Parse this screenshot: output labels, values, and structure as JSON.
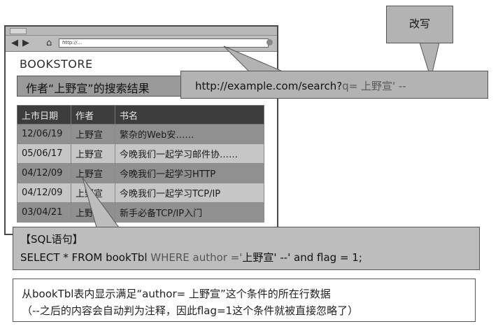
{
  "browser": {
    "url": "http://...",
    "store_name": "BOOKSTORE",
    "result_heading": "作者“上野宣”的搜索结果",
    "columns": [
      "上市日期",
      "作者",
      "书名"
    ],
    "rows": [
      {
        "date": "12/06/19",
        "author": "上野宣",
        "title": "繁杂的Web安……"
      },
      {
        "date": "05/06/17",
        "author": "上野宣",
        "title": "今晚我们一起学习邮件协……"
      },
      {
        "date": "04/12/09",
        "author": "上野宣",
        "title": "今晚我们一起学习HTTP"
      },
      {
        "date": "04/12/09",
        "author": "上野宣",
        "title": "今晚我们一起学习TCP/IP"
      },
      {
        "date": "03/04/21",
        "author": "上野宣",
        "title": "新手必备TCP/IP入门"
      }
    ]
  },
  "url_callout": {
    "plain": "http://example.com/search?",
    "injected": "q= 上野宣' --"
  },
  "rewrite_label": "改写",
  "sql": {
    "heading": "【SQL语句】",
    "active_part": "SELECT * FROM bookTbl ",
    "dim_part": "WHERE author ='",
    "value_part": "上野宣' --",
    "tail_part": "' and flag = 1;"
  },
  "explanation": {
    "line1": "从bookTbl表内显示满足“author= 上野宣”这个条件的所在行数据",
    "line2": "（--之后的内容会自动判为注释，因此flag=1这个条件就被直接忽略了）"
  }
}
